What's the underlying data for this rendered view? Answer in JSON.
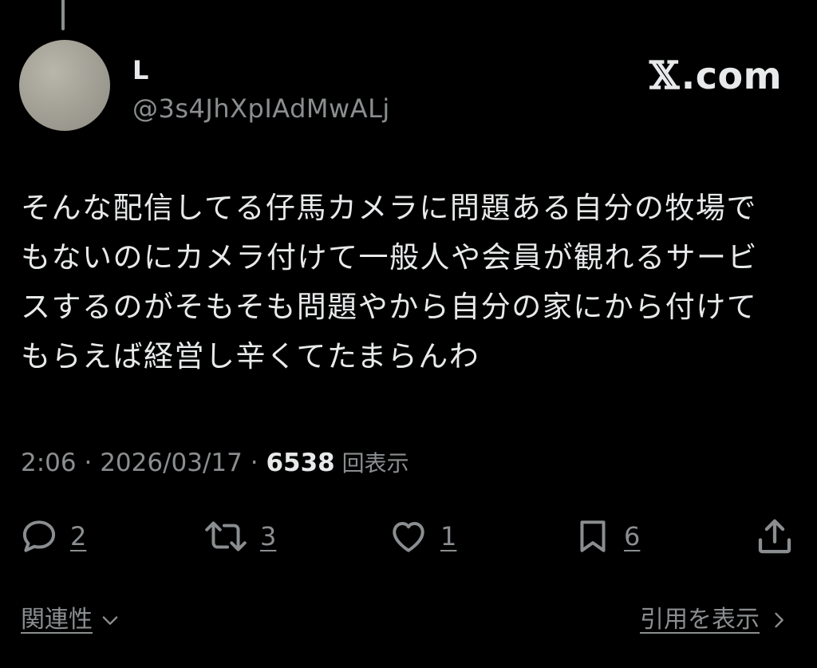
{
  "author": {
    "display_name": "L",
    "handle": "@3s4JhXpIAdMwALj"
  },
  "brand": {
    "name": ".com",
    "logo_icon": "x-logo-icon"
  },
  "tweet": {
    "text": "そんな配信してる仔馬カメラに問題ある自分の牧場でもないのにカメラ付けて一般人や会員が観れるサービスするのがそもそも問題やから自分の家にから付けてもらえば経営し辛くてたまらんわ"
  },
  "meta": {
    "time": "2:06",
    "separator1": " · ",
    "date": "2026/03/17",
    "separator2": " · ",
    "views_count": "6538",
    "views_label": " 回表示"
  },
  "actions": {
    "replies": {
      "icon": "reply-icon",
      "count": "2"
    },
    "retweets": {
      "icon": "retweet-icon",
      "count": "3"
    },
    "likes": {
      "icon": "heart-icon",
      "count": "1"
    },
    "bookmarks": {
      "icon": "bookmark-icon",
      "count": "6"
    },
    "share": {
      "icon": "share-icon"
    }
  },
  "footer": {
    "related_label": "関連性",
    "quotes_label": "引用を表示"
  },
  "colors": {
    "background": "#000000",
    "primary_text": "#e7e9ea",
    "secondary_text": "#8b8e90"
  }
}
